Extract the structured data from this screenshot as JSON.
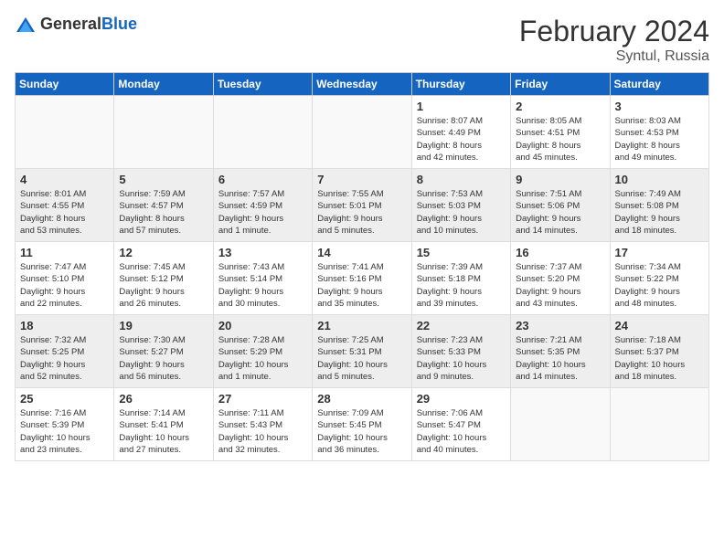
{
  "header": {
    "logo_general": "General",
    "logo_blue": "Blue",
    "month_year": "February 2024",
    "location": "Syntul, Russia"
  },
  "days_of_week": [
    "Sunday",
    "Monday",
    "Tuesday",
    "Wednesday",
    "Thursday",
    "Friday",
    "Saturday"
  ],
  "weeks": [
    {
      "shade": "odd",
      "days": [
        {
          "num": "",
          "info": ""
        },
        {
          "num": "",
          "info": ""
        },
        {
          "num": "",
          "info": ""
        },
        {
          "num": "",
          "info": ""
        },
        {
          "num": "1",
          "info": "Sunrise: 8:07 AM\nSunset: 4:49 PM\nDaylight: 8 hours\nand 42 minutes."
        },
        {
          "num": "2",
          "info": "Sunrise: 8:05 AM\nSunset: 4:51 PM\nDaylight: 8 hours\nand 45 minutes."
        },
        {
          "num": "3",
          "info": "Sunrise: 8:03 AM\nSunset: 4:53 PM\nDaylight: 8 hours\nand 49 minutes."
        }
      ]
    },
    {
      "shade": "even",
      "days": [
        {
          "num": "4",
          "info": "Sunrise: 8:01 AM\nSunset: 4:55 PM\nDaylight: 8 hours\nand 53 minutes."
        },
        {
          "num": "5",
          "info": "Sunrise: 7:59 AM\nSunset: 4:57 PM\nDaylight: 8 hours\nand 57 minutes."
        },
        {
          "num": "6",
          "info": "Sunrise: 7:57 AM\nSunset: 4:59 PM\nDaylight: 9 hours\nand 1 minute."
        },
        {
          "num": "7",
          "info": "Sunrise: 7:55 AM\nSunset: 5:01 PM\nDaylight: 9 hours\nand 5 minutes."
        },
        {
          "num": "8",
          "info": "Sunrise: 7:53 AM\nSunset: 5:03 PM\nDaylight: 9 hours\nand 10 minutes."
        },
        {
          "num": "9",
          "info": "Sunrise: 7:51 AM\nSunset: 5:06 PM\nDaylight: 9 hours\nand 14 minutes."
        },
        {
          "num": "10",
          "info": "Sunrise: 7:49 AM\nSunset: 5:08 PM\nDaylight: 9 hours\nand 18 minutes."
        }
      ]
    },
    {
      "shade": "odd",
      "days": [
        {
          "num": "11",
          "info": "Sunrise: 7:47 AM\nSunset: 5:10 PM\nDaylight: 9 hours\nand 22 minutes."
        },
        {
          "num": "12",
          "info": "Sunrise: 7:45 AM\nSunset: 5:12 PM\nDaylight: 9 hours\nand 26 minutes."
        },
        {
          "num": "13",
          "info": "Sunrise: 7:43 AM\nSunset: 5:14 PM\nDaylight: 9 hours\nand 30 minutes."
        },
        {
          "num": "14",
          "info": "Sunrise: 7:41 AM\nSunset: 5:16 PM\nDaylight: 9 hours\nand 35 minutes."
        },
        {
          "num": "15",
          "info": "Sunrise: 7:39 AM\nSunset: 5:18 PM\nDaylight: 9 hours\nand 39 minutes."
        },
        {
          "num": "16",
          "info": "Sunrise: 7:37 AM\nSunset: 5:20 PM\nDaylight: 9 hours\nand 43 minutes."
        },
        {
          "num": "17",
          "info": "Sunrise: 7:34 AM\nSunset: 5:22 PM\nDaylight: 9 hours\nand 48 minutes."
        }
      ]
    },
    {
      "shade": "even",
      "days": [
        {
          "num": "18",
          "info": "Sunrise: 7:32 AM\nSunset: 5:25 PM\nDaylight: 9 hours\nand 52 minutes."
        },
        {
          "num": "19",
          "info": "Sunrise: 7:30 AM\nSunset: 5:27 PM\nDaylight: 9 hours\nand 56 minutes."
        },
        {
          "num": "20",
          "info": "Sunrise: 7:28 AM\nSunset: 5:29 PM\nDaylight: 10 hours\nand 1 minute."
        },
        {
          "num": "21",
          "info": "Sunrise: 7:25 AM\nSunset: 5:31 PM\nDaylight: 10 hours\nand 5 minutes."
        },
        {
          "num": "22",
          "info": "Sunrise: 7:23 AM\nSunset: 5:33 PM\nDaylight: 10 hours\nand 9 minutes."
        },
        {
          "num": "23",
          "info": "Sunrise: 7:21 AM\nSunset: 5:35 PM\nDaylight: 10 hours\nand 14 minutes."
        },
        {
          "num": "24",
          "info": "Sunrise: 7:18 AM\nSunset: 5:37 PM\nDaylight: 10 hours\nand 18 minutes."
        }
      ]
    },
    {
      "shade": "odd",
      "days": [
        {
          "num": "25",
          "info": "Sunrise: 7:16 AM\nSunset: 5:39 PM\nDaylight: 10 hours\nand 23 minutes."
        },
        {
          "num": "26",
          "info": "Sunrise: 7:14 AM\nSunset: 5:41 PM\nDaylight: 10 hours\nand 27 minutes."
        },
        {
          "num": "27",
          "info": "Sunrise: 7:11 AM\nSunset: 5:43 PM\nDaylight: 10 hours\nand 32 minutes."
        },
        {
          "num": "28",
          "info": "Sunrise: 7:09 AM\nSunset: 5:45 PM\nDaylight: 10 hours\nand 36 minutes."
        },
        {
          "num": "29",
          "info": "Sunrise: 7:06 AM\nSunset: 5:47 PM\nDaylight: 10 hours\nand 40 minutes."
        },
        {
          "num": "",
          "info": ""
        },
        {
          "num": "",
          "info": ""
        }
      ]
    }
  ]
}
